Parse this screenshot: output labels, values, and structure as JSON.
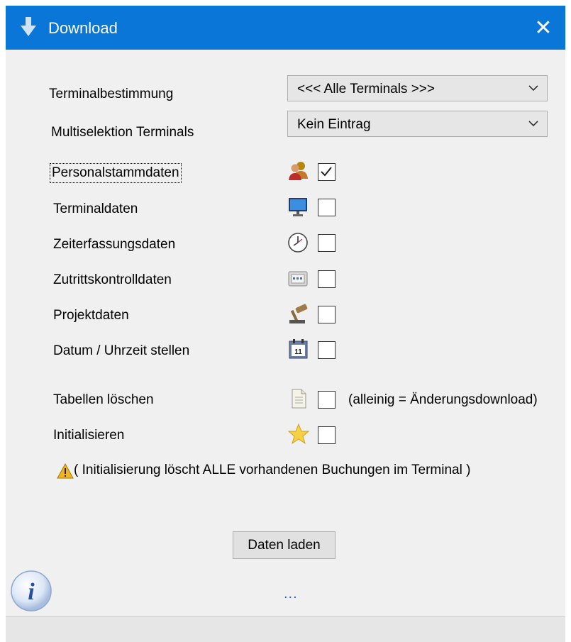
{
  "window": {
    "title": "Download",
    "close_glyph": "✕"
  },
  "terminal_select": {
    "label": "Terminalbestimmung",
    "value": "<<< Alle Terminals >>>"
  },
  "multiselect": {
    "label": "Multiselektion Terminals",
    "value": "Kein Eintrag"
  },
  "options": [
    {
      "label": "Personalstammdaten",
      "icon": "users-icon",
      "checked": true,
      "focused": true
    },
    {
      "label": "Terminaldaten",
      "icon": "monitor-icon",
      "checked": false
    },
    {
      "label": "Zeiterfassungsdaten",
      "icon": "clock-icon",
      "checked": false
    },
    {
      "label": "Zutrittskontrolldaten",
      "icon": "keypad-icon",
      "checked": false
    },
    {
      "label": "Projektdaten",
      "icon": "gavel-icon",
      "checked": false
    },
    {
      "label": "Datum / Uhrzeit stellen",
      "icon": "calendar-icon",
      "checked": false
    },
    {
      "label": "Tabellen löschen",
      "icon": "document-icon",
      "checked": false,
      "note": "(alleinig = Änderungsdownload)"
    },
    {
      "label": "Initialisieren",
      "icon": "star-icon",
      "checked": false
    }
  ],
  "calendar_day": "11",
  "warning": {
    "text": "( Initialisierung löscht ALLE vorhandenen Buchungen im Terminal )",
    "icon": "warning-icon"
  },
  "load_button": "Daten laden",
  "status_dots": "...",
  "info_glyph": "i"
}
